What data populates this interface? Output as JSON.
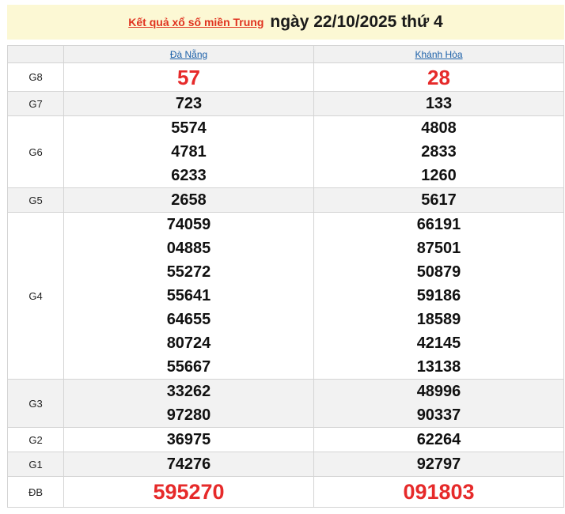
{
  "header": {
    "title_link": "Kết quả xổ số miền Trung",
    "date_text": "ngày 22/10/2025 thứ 4"
  },
  "provinces": [
    "Đà Nẵng",
    "Khánh Hòa"
  ],
  "prizes": {
    "g8": {
      "label": "G8",
      "da_nang": [
        "57"
      ],
      "khanh_hoa": [
        "28"
      ]
    },
    "g7": {
      "label": "G7",
      "da_nang": [
        "723"
      ],
      "khanh_hoa": [
        "133"
      ]
    },
    "g6": {
      "label": "G6",
      "da_nang": [
        "5574",
        "4781",
        "6233"
      ],
      "khanh_hoa": [
        "4808",
        "2833",
        "1260"
      ]
    },
    "g5": {
      "label": "G5",
      "da_nang": [
        "2658"
      ],
      "khanh_hoa": [
        "5617"
      ]
    },
    "g4": {
      "label": "G4",
      "da_nang": [
        "74059",
        "04885",
        "55272",
        "55641",
        "64655",
        "80724",
        "55667"
      ],
      "khanh_hoa": [
        "66191",
        "87501",
        "50879",
        "59186",
        "18589",
        "42145",
        "13138"
      ]
    },
    "g3": {
      "label": "G3",
      "da_nang": [
        "33262",
        "97280"
      ],
      "khanh_hoa": [
        "48996",
        "90337"
      ]
    },
    "g2": {
      "label": "G2",
      "da_nang": [
        "36975"
      ],
      "khanh_hoa": [
        "62264"
      ]
    },
    "g1": {
      "label": "G1",
      "da_nang": [
        "74276"
      ],
      "khanh_hoa": [
        "92797"
      ]
    },
    "db": {
      "label": "ĐB",
      "da_nang": [
        "595270"
      ],
      "khanh_hoa": [
        "091803"
      ]
    }
  },
  "colors": {
    "header_bg": "#fcf8d4",
    "title_link": "#e0321f",
    "province_link": "#1a5fa8",
    "highlight_number": "#e62a2a",
    "row_shade": "#f2f2f2"
  }
}
